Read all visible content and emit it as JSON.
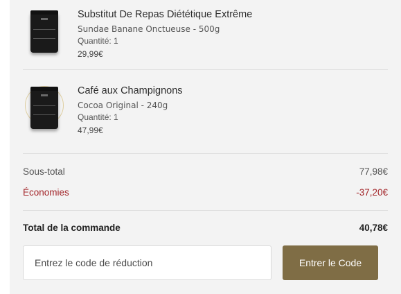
{
  "cart": {
    "items": [
      {
        "title": "Substitut De Repas Diététique Extrême",
        "variant": "Sundae Banane Onctueuse  -  500g",
        "quantity": "Quantité: 1",
        "price": "29,99€",
        "thumbnail_icon": "meal-replacement-pouch-icon"
      },
      {
        "title": "Café aux Champignons",
        "variant": "Cocoa Original  -  240g",
        "quantity": "Quantité: 1",
        "price": "47,99€",
        "thumbnail_icon": "mushroom-coffee-pouch-icon"
      }
    ]
  },
  "summary": {
    "subtotal_label": "Sous-total",
    "subtotal_value": "77,98€",
    "savings_label": "Économies",
    "savings_value": "-37,20€",
    "total_label": "Total de la commande",
    "total_value": "40,78€"
  },
  "promo": {
    "placeholder": "Entrez le code de réduction",
    "button_label": "Entrer le Code"
  },
  "colors": {
    "panel_bg": "#f3f3f3",
    "savings": "#a3262a",
    "button_bg": "#7f6d45"
  }
}
